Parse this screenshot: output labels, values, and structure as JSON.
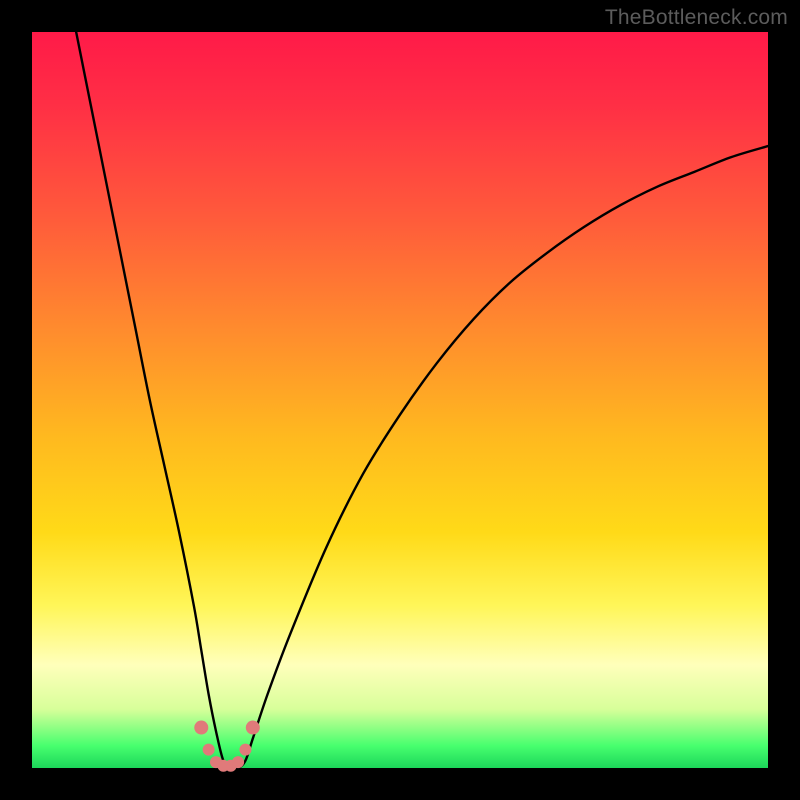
{
  "watermark": "TheBottleneck.com",
  "chart_data": {
    "type": "line",
    "title": "",
    "xlabel": "",
    "ylabel": "",
    "xlim": [
      0,
      100
    ],
    "ylim": [
      0,
      100
    ],
    "grid": false,
    "legend": false,
    "series": [
      {
        "name": "bottleneck-curve",
        "color": "#000000",
        "x": [
          6,
          8,
          10,
          12,
          14,
          16,
          18,
          20,
          22,
          23,
          24,
          25,
          26,
          27,
          28,
          29,
          30,
          32,
          35,
          40,
          45,
          50,
          55,
          60,
          65,
          70,
          75,
          80,
          85,
          90,
          95,
          100
        ],
        "y": [
          100,
          90,
          80,
          70,
          60,
          50,
          41,
          32,
          22,
          16,
          10,
          5,
          1,
          0,
          0,
          1,
          4,
          10,
          18,
          30,
          40,
          48,
          55,
          61,
          66,
          70,
          73.5,
          76.5,
          79,
          81,
          83,
          84.5
        ]
      },
      {
        "name": "bottom-marker-dots",
        "color": "#e07a7a",
        "type": "scatter",
        "x": [
          23.0,
          24.0,
          25.0,
          26.0,
          27.0,
          28.0,
          29.0,
          30.0
        ],
        "y": [
          5.5,
          2.5,
          0.8,
          0.3,
          0.3,
          0.8,
          2.5,
          5.5
        ]
      }
    ],
    "annotations": []
  }
}
